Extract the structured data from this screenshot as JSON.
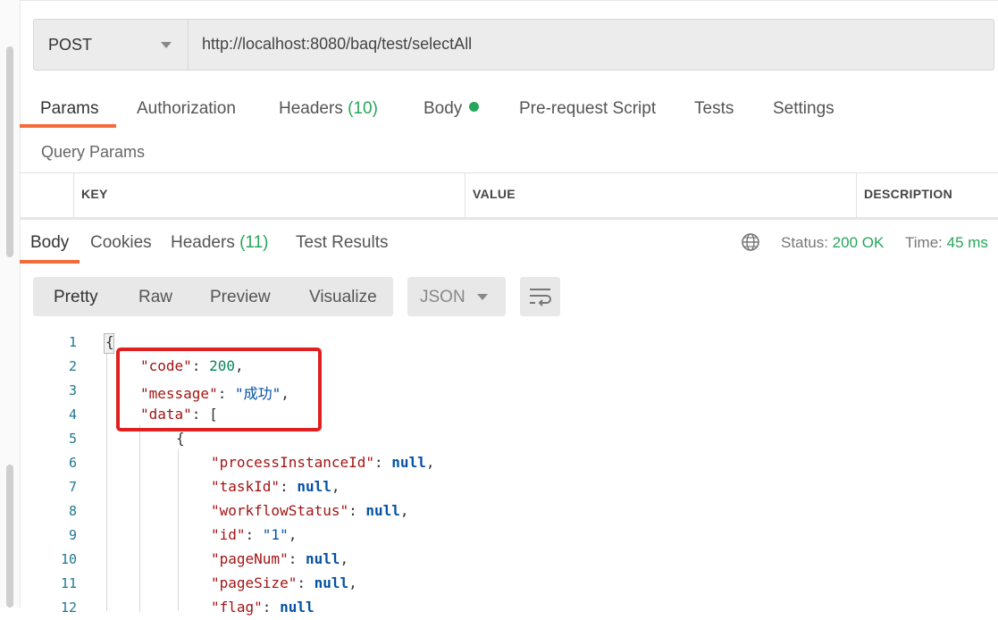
{
  "request": {
    "method": "POST",
    "url": "http://localhost:8080/baq/test/selectAll"
  },
  "request_tabs": [
    {
      "label": "Params"
    },
    {
      "label": "Authorization"
    },
    {
      "label": "Headers",
      "count": "(10)"
    },
    {
      "label": "Body"
    },
    {
      "label": "Pre-request Script"
    },
    {
      "label": "Tests"
    },
    {
      "label": "Settings"
    }
  ],
  "query_params": {
    "title": "Query Params",
    "columns": [
      "KEY",
      "VALUE",
      "DESCRIPTION"
    ]
  },
  "response_tabs": [
    {
      "label": "Body"
    },
    {
      "label": "Cookies"
    },
    {
      "label": "Headers",
      "count": "(11)"
    },
    {
      "label": "Test Results"
    }
  ],
  "response_status": {
    "status_label": "Status:",
    "status_value": "200 OK",
    "time_label": "Time:",
    "time_value": "45 ms"
  },
  "view_modes": [
    "Pretty",
    "Raw",
    "Preview",
    "Visualize"
  ],
  "format": "JSON",
  "icons": {
    "method_dropdown": "chevron-down-icon",
    "globe": "globe-icon",
    "wrap": "wrap-lines-icon",
    "body_indicator": "status-dot-icon"
  },
  "colors": {
    "accent": "#f26b3a",
    "success": "#26a65b",
    "highlight_box": "#e02020"
  },
  "code_lines": [
    {
      "n": "1",
      "indent": 0,
      "parts": [
        {
          "t": "{",
          "c": ""
        }
      ]
    },
    {
      "n": "2",
      "indent": 1,
      "parts": [
        {
          "t": "\"code\"",
          "c": "k"
        },
        {
          "t": ": ",
          "c": ""
        },
        {
          "t": "200",
          "c": "n"
        },
        {
          "t": ",",
          "c": ""
        }
      ]
    },
    {
      "n": "3",
      "indent": 1,
      "parts": [
        {
          "t": "\"message\"",
          "c": "k"
        },
        {
          "t": ": ",
          "c": ""
        },
        {
          "t": "\"成功\"",
          "c": "s"
        },
        {
          "t": ",",
          "c": ""
        }
      ]
    },
    {
      "n": "4",
      "indent": 1,
      "parts": [
        {
          "t": "\"data\"",
          "c": "k"
        },
        {
          "t": ": [",
          "c": ""
        }
      ]
    },
    {
      "n": "5",
      "indent": 2,
      "parts": [
        {
          "t": "{",
          "c": ""
        }
      ]
    },
    {
      "n": "6",
      "indent": 3,
      "parts": [
        {
          "t": "\"processInstanceId\"",
          "c": "k"
        },
        {
          "t": ": ",
          "c": ""
        },
        {
          "t": "null",
          "c": "nl"
        },
        {
          "t": ",",
          "c": ""
        }
      ]
    },
    {
      "n": "7",
      "indent": 3,
      "parts": [
        {
          "t": "\"taskId\"",
          "c": "k"
        },
        {
          "t": ": ",
          "c": ""
        },
        {
          "t": "null",
          "c": "nl"
        },
        {
          "t": ",",
          "c": ""
        }
      ]
    },
    {
      "n": "8",
      "indent": 3,
      "parts": [
        {
          "t": "\"workflowStatus\"",
          "c": "k"
        },
        {
          "t": ": ",
          "c": ""
        },
        {
          "t": "null",
          "c": "nl"
        },
        {
          "t": ",",
          "c": ""
        }
      ]
    },
    {
      "n": "9",
      "indent": 3,
      "parts": [
        {
          "t": "\"id\"",
          "c": "k"
        },
        {
          "t": ": ",
          "c": ""
        },
        {
          "t": "\"1\"",
          "c": "s"
        },
        {
          "t": ",",
          "c": ""
        }
      ]
    },
    {
      "n": "10",
      "indent": 3,
      "parts": [
        {
          "t": "\"pageNum\"",
          "c": "k"
        },
        {
          "t": ": ",
          "c": ""
        },
        {
          "t": "null",
          "c": "nl"
        },
        {
          "t": ",",
          "c": ""
        }
      ]
    },
    {
      "n": "11",
      "indent": 3,
      "parts": [
        {
          "t": "\"pageSize\"",
          "c": "k"
        },
        {
          "t": ": ",
          "c": ""
        },
        {
          "t": "null",
          "c": "nl"
        },
        {
          "t": ",",
          "c": ""
        }
      ]
    },
    {
      "n": "12",
      "indent": 3,
      "parts": [
        {
          "t": "\"flag\"",
          "c": "k"
        },
        {
          "t": ": ",
          "c": ""
        },
        {
          "t": "null",
          "c": "nl"
        }
      ]
    }
  ]
}
